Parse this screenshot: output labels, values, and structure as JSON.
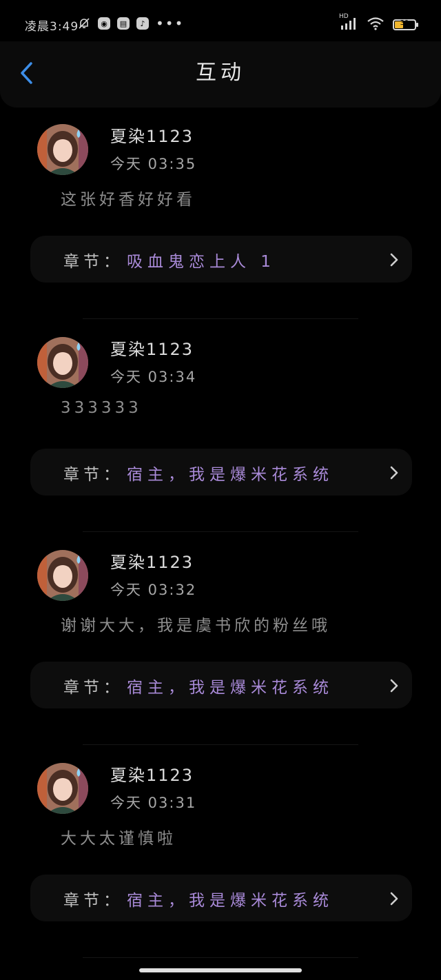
{
  "status_bar": {
    "time": "凌晨3:49",
    "battery": "39",
    "network": "HD"
  },
  "header": {
    "title": "互动"
  },
  "chapter_label": "章节：",
  "comments": [
    {
      "username": "夏染1123",
      "time": "今天 03:35",
      "text": "这张好香好好看",
      "chapter": "吸血鬼恋上人 1"
    },
    {
      "username": "夏染1123",
      "time": "今天 03:34",
      "text": "333333",
      "chapter": "宿主，我是爆米花系统"
    },
    {
      "username": "夏染1123",
      "time": "今天 03:32",
      "text": "谢谢大大，我是虞书欣的粉丝哦",
      "chapter": "宿主，我是爆米花系统"
    },
    {
      "username": "夏染1123",
      "time": "今天 03:31",
      "text": "大大太谨慎啦",
      "chapter": "宿主，我是爆米花系统"
    }
  ],
  "colors": {
    "background": "#000000",
    "chapter_name": "#a98ad8",
    "back_arrow": "#3d8ee8"
  }
}
